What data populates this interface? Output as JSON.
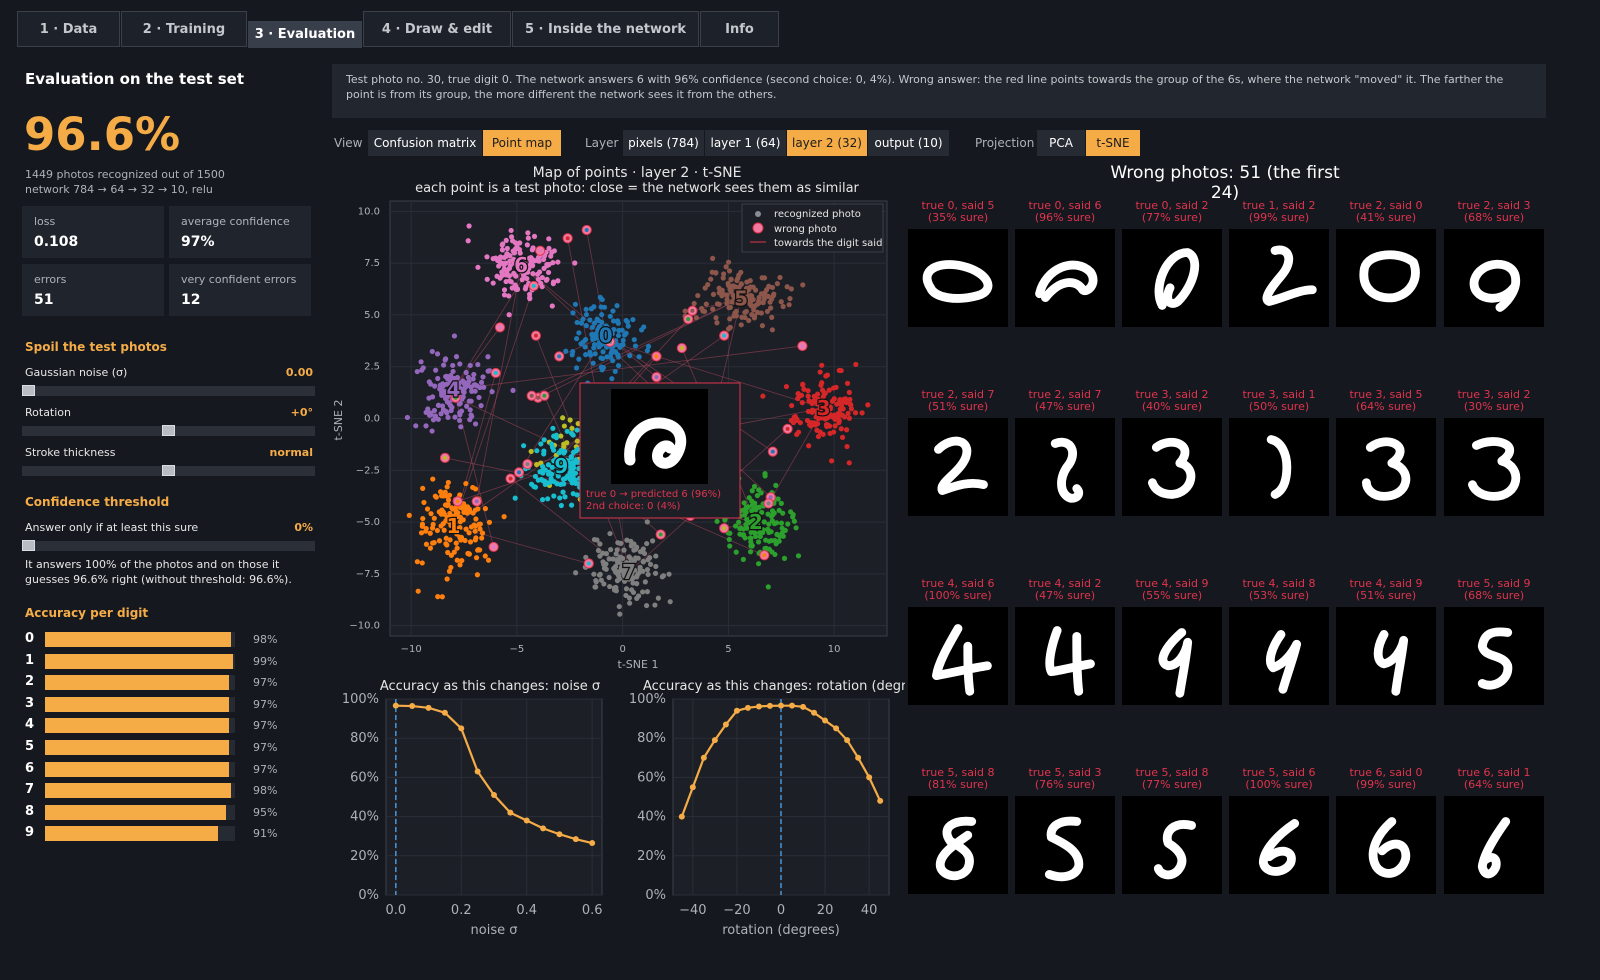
{
  "tabs": [
    {
      "label": "1 · Data"
    },
    {
      "label": "2 · Training"
    },
    {
      "label": "3 · Evaluation",
      "active": true
    },
    {
      "label": "4 · Draw & edit"
    },
    {
      "label": "5 · Inside the network"
    },
    {
      "label": "Info"
    }
  ],
  "left": {
    "title": "Evaluation on the test set",
    "accuracy": "96.6%",
    "recognized": "1449 photos recognized out of 1500",
    "network": "network 784 → 64 → 32 → 10, relu",
    "stats": [
      {
        "label": "loss",
        "value": "0.108"
      },
      {
        "label": "average confidence",
        "value": "97%"
      },
      {
        "label": "errors",
        "value": "51"
      },
      {
        "label": "very confident errors",
        "value": "12"
      }
    ],
    "spoil_title": "Spoil the test photos",
    "sliders": [
      {
        "label": "Gaussian noise (σ)",
        "value": "0.00",
        "level": 0.0
      },
      {
        "label": "Rotation",
        "value": "+0°",
        "level": 0.5
      },
      {
        "label": "Stroke thickness",
        "value": "normal",
        "level": 0.5
      }
    ],
    "threshold_title": "Confidence threshold",
    "threshold": {
      "label": "Answer only if at least this sure",
      "value": "0%",
      "level": 0.0
    },
    "threshold_note": "It answers 100% of the photos and on those it guesses 96.6% right (without threshold: 96.6%).",
    "per_digit_title": "Accuracy per digit",
    "per_digit": [
      {
        "digit": "0",
        "pct": "98%",
        "value": 0.98
      },
      {
        "digit": "1",
        "pct": "99%",
        "value": 0.99
      },
      {
        "digit": "2",
        "pct": "97%",
        "value": 0.97
      },
      {
        "digit": "3",
        "pct": "97%",
        "value": 0.97
      },
      {
        "digit": "4",
        "pct": "97%",
        "value": 0.97
      },
      {
        "digit": "5",
        "pct": "97%",
        "value": 0.97
      },
      {
        "digit": "6",
        "pct": "97%",
        "value": 0.97
      },
      {
        "digit": "7",
        "pct": "98%",
        "value": 0.98
      },
      {
        "digit": "8",
        "pct": "95%",
        "value": 0.95
      },
      {
        "digit": "9",
        "pct": "91%",
        "value": 0.91
      }
    ]
  },
  "description": "Test photo no. 30, true digit 0. The network answers 6 with 96% confidence (second choice: 0, 4%). Wrong answer: the red line points towards the group of the 6s, where the network \"moved\" it. The farther the point is from its group, the more different the network sees it from the others.",
  "controls": {
    "view_label": "View",
    "view_options": [
      {
        "label": "Confusion matrix"
      },
      {
        "label": "Point map",
        "active": true
      }
    ],
    "layer_label": "Layer",
    "layer_options": [
      {
        "label": "pixels (784)"
      },
      {
        "label": "layer 1 (64)"
      },
      {
        "label": "layer 2 (32)",
        "active": true
      },
      {
        "label": "output (10)"
      }
    ],
    "projection_label": "Projection",
    "projection_options": [
      {
        "label": "PCA"
      },
      {
        "label": "t-SNE",
        "active": true
      }
    ]
  },
  "colors": {
    "accent": "#f5ac47",
    "error": "#e0344e",
    "digits": [
      "#1f77b4",
      "#ff7f0e",
      "#2ca02c",
      "#d62728",
      "#9467bd",
      "#8c564b",
      "#e377c2",
      "#7f7f7f",
      "#bcbd22",
      "#17becf"
    ]
  },
  "chart_data": [
    {
      "type": "scatter",
      "title": "Map of points · layer 2 · t-SNE",
      "subtitle": "each point is a test photo: close = the network sees them as similar",
      "xlabel": "t-SNE 1",
      "ylabel": "t-SNE 2",
      "xlim": [
        -11,
        12.5
      ],
      "ylim": [
        -10.5,
        10.5
      ],
      "xticks": [
        -10,
        -5,
        0,
        5,
        10
      ],
      "yticks": [
        10.0,
        7.5,
        5.0,
        2.5,
        0.0,
        -2.5,
        -5.0,
        -7.5,
        -10.0
      ],
      "ytick_labels": [
        "10.0",
        "7.5",
        "5.0",
        "2.5",
        "0.0",
        "−2.5",
        "−5.0",
        "−7.5",
        "−10.0"
      ],
      "xtick_labels": [
        "−10",
        "−5",
        "0",
        "5",
        "10"
      ],
      "grid": true,
      "legend_position": "top-right",
      "legend": [
        "recognized photo",
        "wrong photo",
        "towards the digit said"
      ],
      "clusters": [
        {
          "digit": "0",
          "center": [
            -0.8,
            4.0
          ],
          "spread": [
            1.3,
            1.5
          ]
        },
        {
          "digit": "1",
          "center": [
            -8.0,
            -5.2
          ],
          "spread": [
            1.6,
            2.0
          ]
        },
        {
          "digit": "2",
          "center": [
            6.3,
            -5.0
          ],
          "spread": [
            1.5,
            1.7
          ]
        },
        {
          "digit": "3",
          "center": [
            9.5,
            0.5
          ],
          "spread": [
            1.5,
            1.5
          ]
        },
        {
          "digit": "4",
          "center": [
            -8.0,
            1.4
          ],
          "spread": [
            1.6,
            1.6
          ]
        },
        {
          "digit": "5",
          "center": [
            5.6,
            5.8
          ],
          "spread": [
            1.8,
            1.4
          ]
        },
        {
          "digit": "6",
          "center": [
            -4.8,
            7.4
          ],
          "spread": [
            1.6,
            1.5
          ]
        },
        {
          "digit": "7",
          "center": [
            0.3,
            -7.4
          ],
          "spread": [
            1.7,
            1.4
          ]
        },
        {
          "digit": "8",
          "center": [
            -2.6,
            -1.5
          ],
          "spread": [
            1.4,
            1.5
          ]
        },
        {
          "digit": "9",
          "center": [
            -2.9,
            -2.3
          ],
          "spread": [
            1.5,
            1.4
          ]
        }
      ],
      "wrong_points": [
        [
          -3.0,
          3.0
        ],
        [
          -4.1,
          4.0
        ],
        [
          -5.8,
          4.4
        ],
        [
          -6.0,
          2.2
        ],
        [
          -7.9,
          1.0
        ],
        [
          -4.0,
          1.0
        ],
        [
          -8.4,
          -1.9
        ],
        [
          -7.8,
          -4.0
        ],
        [
          -6.9,
          -4.0
        ],
        [
          -4.5,
          -2.2
        ],
        [
          -4.9,
          -2.6
        ],
        [
          -5.3,
          -2.9
        ],
        [
          -6.1,
          -6.2
        ],
        [
          -1.6,
          -7.0
        ],
        [
          1.8,
          -5.6
        ],
        [
          3.2,
          -4.7
        ],
        [
          4.8,
          -5.3
        ],
        [
          6.7,
          -6.6
        ],
        [
          7.0,
          -3.8
        ],
        [
          6.9,
          -4.1
        ],
        [
          7.1,
          -1.6
        ],
        [
          7.8,
          -0.5
        ],
        [
          8.5,
          3.5
        ],
        [
          4.8,
          4.0
        ],
        [
          3.1,
          4.8
        ],
        [
          3.3,
          5.2
        ],
        [
          2.8,
          3.4
        ],
        [
          1.6,
          3.0
        ],
        [
          1.6,
          2.0
        ],
        [
          -0.6,
          3.7
        ],
        [
          -1.7,
          9.1
        ],
        [
          -2.6,
          8.7
        ],
        [
          -3.9,
          8.1
        ],
        [
          -4.2,
          6.4
        ],
        [
          -3.7,
          1.1
        ],
        [
          -4.3,
          1.1
        ]
      ],
      "highlight": {
        "true_digit": "0",
        "label": "true 0 → predicted 6 (96%)",
        "label2": "2nd choice: 0 (4%)"
      }
    },
    {
      "type": "line",
      "title": "Accuracy as this changes: noise σ",
      "xlabel": "noise σ",
      "ylabel": "",
      "xlim": [
        -0.03,
        0.63
      ],
      "ylim": [
        0,
        100
      ],
      "xticks": [
        0.0,
        0.2,
        0.4,
        0.6
      ],
      "xtick_labels": [
        "0.0",
        "0.2",
        "0.4",
        "0.6"
      ],
      "yticks": [
        0,
        20,
        40,
        60,
        80,
        100
      ],
      "ytick_labels": [
        "0%",
        "20%",
        "40%",
        "60%",
        "80%",
        "100%"
      ],
      "current_x": 0.0,
      "x": [
        0.0,
        0.05,
        0.1,
        0.15,
        0.2,
        0.25,
        0.3,
        0.35,
        0.4,
        0.45,
        0.5,
        0.55,
        0.6
      ],
      "y": [
        96.6,
        96.4,
        95.5,
        93.0,
        85.0,
        63.0,
        51.0,
        42.0,
        38.0,
        34.0,
        31.0,
        28.5,
        26.5
      ]
    },
    {
      "type": "line",
      "title": "Accuracy as this changes: rotation (degrees)",
      "xlabel": "rotation (degrees)",
      "ylabel": "",
      "xlim": [
        -49,
        49
      ],
      "ylim": [
        0,
        100
      ],
      "xticks": [
        -40,
        -20,
        0,
        20,
        40
      ],
      "xtick_labels": [
        "−40",
        "−20",
        "0",
        "20",
        "40"
      ],
      "yticks": [
        0,
        20,
        40,
        60,
        80,
        100
      ],
      "ytick_labels": [
        "0%",
        "20%",
        "40%",
        "60%",
        "80%",
        "100%"
      ],
      "current_x": 0,
      "x": [
        -45,
        -40,
        -35,
        -30,
        -25,
        -20,
        -15,
        -10,
        -5,
        0,
        5,
        10,
        15,
        20,
        25,
        30,
        35,
        40,
        45
      ],
      "y": [
        40,
        55,
        70,
        79,
        87,
        94,
        95.5,
        96.2,
        96.5,
        96.6,
        96.6,
        96,
        93,
        89,
        85,
        79,
        70,
        60,
        48
      ]
    }
  ],
  "wrong_photos": {
    "title": "Wrong photos: 51 (the first 24)",
    "items": [
      {
        "line1": "true 0, said 5",
        "line2": "(35% sure)"
      },
      {
        "line1": "true 0, said 6",
        "line2": "(96% sure)"
      },
      {
        "line1": "true 0, said 2",
        "line2": "(77% sure)"
      },
      {
        "line1": "true 1, said 2",
        "line2": "(99% sure)"
      },
      {
        "line1": "true 2, said 0",
        "line2": "(41% sure)"
      },
      {
        "line1": "true 2, said 3",
        "line2": "(68% sure)"
      },
      {
        "line1": "true 2, said 7",
        "line2": "(51% sure)"
      },
      {
        "line1": "true 2, said 7",
        "line2": "(47% sure)"
      },
      {
        "line1": "true 3, said 2",
        "line2": "(40% sure)"
      },
      {
        "line1": "true 3, said 1",
        "line2": "(50% sure)"
      },
      {
        "line1": "true 3, said 5",
        "line2": "(64% sure)"
      },
      {
        "line1": "true 3, said 2",
        "line2": "(30% sure)"
      },
      {
        "line1": "true 4, said 6",
        "line2": "(100% sure)"
      },
      {
        "line1": "true 4, said 2",
        "line2": "(47% sure)"
      },
      {
        "line1": "true 4, said 9",
        "line2": "(55% sure)"
      },
      {
        "line1": "true 4, said 8",
        "line2": "(53% sure)"
      },
      {
        "line1": "true 4, said 9",
        "line2": "(51% sure)"
      },
      {
        "line1": "true 5, said 9",
        "line2": "(68% sure)"
      },
      {
        "line1": "true 5, said 8",
        "line2": "(81% sure)"
      },
      {
        "line1": "true 5, said 3",
        "line2": "(76% sure)"
      },
      {
        "line1": "true 5, said 8",
        "line2": "(77% sure)"
      },
      {
        "line1": "true 5, said 6",
        "line2": "(100% sure)"
      },
      {
        "line1": "true 6, said 0",
        "line2": "(99% sure)"
      },
      {
        "line1": "true 6, said 1",
        "line2": "(64% sure)"
      }
    ]
  }
}
